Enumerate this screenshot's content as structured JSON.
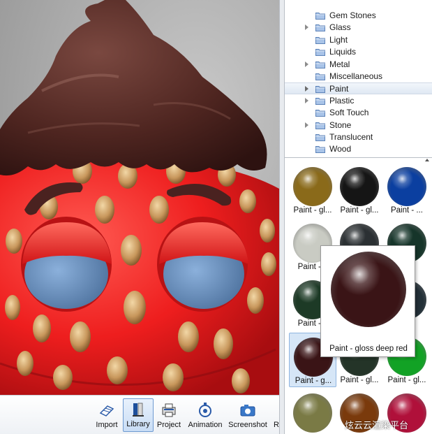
{
  "library_tree": {
    "items": [
      {
        "label": "Gem Stones",
        "expandable": false,
        "selected": false
      },
      {
        "label": "Glass",
        "expandable": true,
        "selected": false
      },
      {
        "label": "Light",
        "expandable": false,
        "selected": false
      },
      {
        "label": "Liquids",
        "expandable": false,
        "selected": false
      },
      {
        "label": "Metal",
        "expandable": true,
        "selected": false
      },
      {
        "label": "Miscellaneous",
        "expandable": false,
        "selected": false
      },
      {
        "label": "Paint",
        "expandable": true,
        "selected": true
      },
      {
        "label": "Plastic",
        "expandable": true,
        "selected": false
      },
      {
        "label": "Soft Touch",
        "expandable": false,
        "selected": false
      },
      {
        "label": "Stone",
        "expandable": true,
        "selected": false
      },
      {
        "label": "Translucent",
        "expandable": false,
        "selected": false
      },
      {
        "label": "Wood",
        "expandable": false,
        "selected": false
      }
    ]
  },
  "materials": [
    {
      "label": "Paint - gl...",
      "color": "#8a6a1a"
    },
    {
      "label": "Paint - gl...",
      "color": "#151515"
    },
    {
      "label": "Paint - ...",
      "color": "#0b3fa0"
    },
    {
      "label": "Paint - g",
      "color": "#c9cbc3"
    },
    {
      "label": "",
      "color": "#2b3033"
    },
    {
      "label": "",
      "color": "#16352a"
    },
    {
      "label": "Paint - g",
      "color": "#1d3a26"
    },
    {
      "label": "",
      "color": "#1e2a2c"
    },
    {
      "label": "",
      "color": "#233038"
    },
    {
      "label": "Paint - g...",
      "color": "#3a1416",
      "selected": true
    },
    {
      "label": "Paint - gl...",
      "color": "#243428"
    },
    {
      "label": "Paint - gl...",
      "color": "#12a225"
    },
    {
      "label": "",
      "color": "#7a7a45"
    },
    {
      "label": "",
      "color": "#7a3a0c"
    },
    {
      "label": "",
      "color": "#b0103a"
    }
  ],
  "tooltip": {
    "label": "Paint - gloss deep red",
    "color": "#3a1416"
  },
  "toolbar": {
    "import": "Import",
    "library": "Library",
    "project": "Project",
    "animation": "Animation",
    "screenshot": "Screenshot",
    "render_partial": "R"
  },
  "watermark": "炫云云渲染平台"
}
